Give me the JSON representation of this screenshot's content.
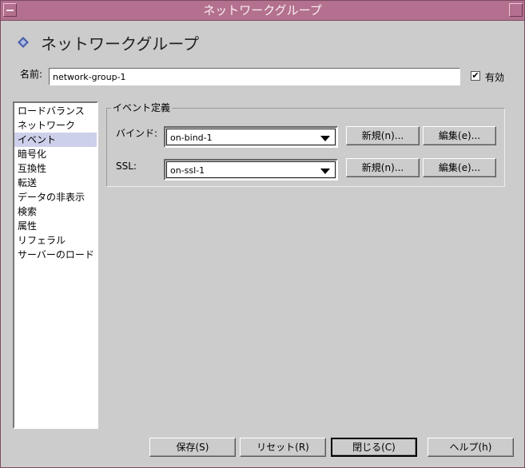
{
  "window": {
    "title": "ネットワークグループ"
  },
  "header": {
    "title": "ネットワークグループ",
    "icon": "diamond-icon"
  },
  "name_field": {
    "label": "名前:",
    "value": "network-group-1"
  },
  "enabled": {
    "label": "有効",
    "checked": true
  },
  "nav": {
    "items": [
      {
        "label": "ロードバランス"
      },
      {
        "label": "ネットワーク"
      },
      {
        "label": "イベント",
        "selected": true
      },
      {
        "label": "暗号化"
      },
      {
        "label": "互換性"
      },
      {
        "label": "転送"
      },
      {
        "label": "データの非表示"
      },
      {
        "label": "検索"
      },
      {
        "label": "属性"
      },
      {
        "label": "リフェラル"
      },
      {
        "label": "サーバーのロード"
      }
    ]
  },
  "events_group": {
    "title": "イベント定義",
    "bind": {
      "label": "バインド:",
      "value": "on-bind-1",
      "new_label": "新規(n)...",
      "edit_label": "編集(e)..."
    },
    "ssl": {
      "label": "SSL:",
      "value": "on-ssl-1",
      "new_label": "新規(n)...",
      "edit_label": "編集(e)..."
    }
  },
  "footer": {
    "save_label": "保存(S)",
    "reset_label": "リセット(R)",
    "close_label": "閉じる(C)",
    "help_label": "ヘルプ(h)"
  },
  "colors": {
    "titlebar": "#b3708f",
    "background": "#cccccc",
    "selection": "#ccd0ea",
    "header_icon": "#4a5fa8"
  }
}
